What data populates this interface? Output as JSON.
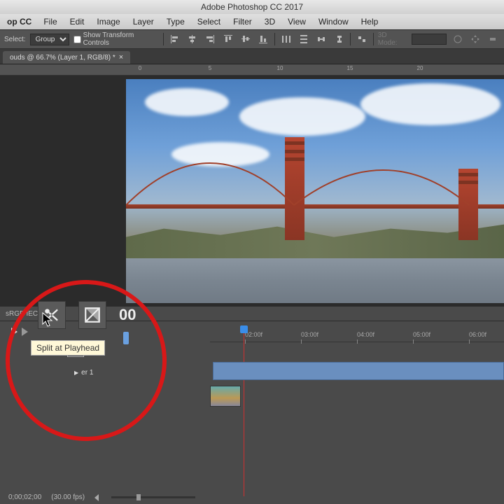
{
  "titlebar": {
    "title": "Adobe Photoshop CC 2017"
  },
  "appmenu": "op CC",
  "menus": [
    "File",
    "Edit",
    "Image",
    "Layer",
    "Type",
    "Select",
    "Filter",
    "3D",
    "View",
    "Window",
    "Help"
  ],
  "options": {
    "autoselect_label": "Select:",
    "autoselect_value": "Group",
    "showtransform_label": "Show Transform Controls",
    "threed_label": "3D Mode:"
  },
  "doctab": {
    "title": "ouds @ 66.7% (Layer 1, RGB/8) *",
    "close": "×"
  },
  "status": {
    "profile": "sRGB IEC"
  },
  "timeline": {
    "timecode": "00",
    "ruler_marks": [
      "02:00f",
      "03:00f",
      "04:00f",
      "05:00f",
      "06:00f"
    ],
    "layer_label": "er 1",
    "tooltip": "Split at Playhead",
    "footer_time": "0;00;02;00",
    "footer_fps": "(30.00 fps)"
  }
}
